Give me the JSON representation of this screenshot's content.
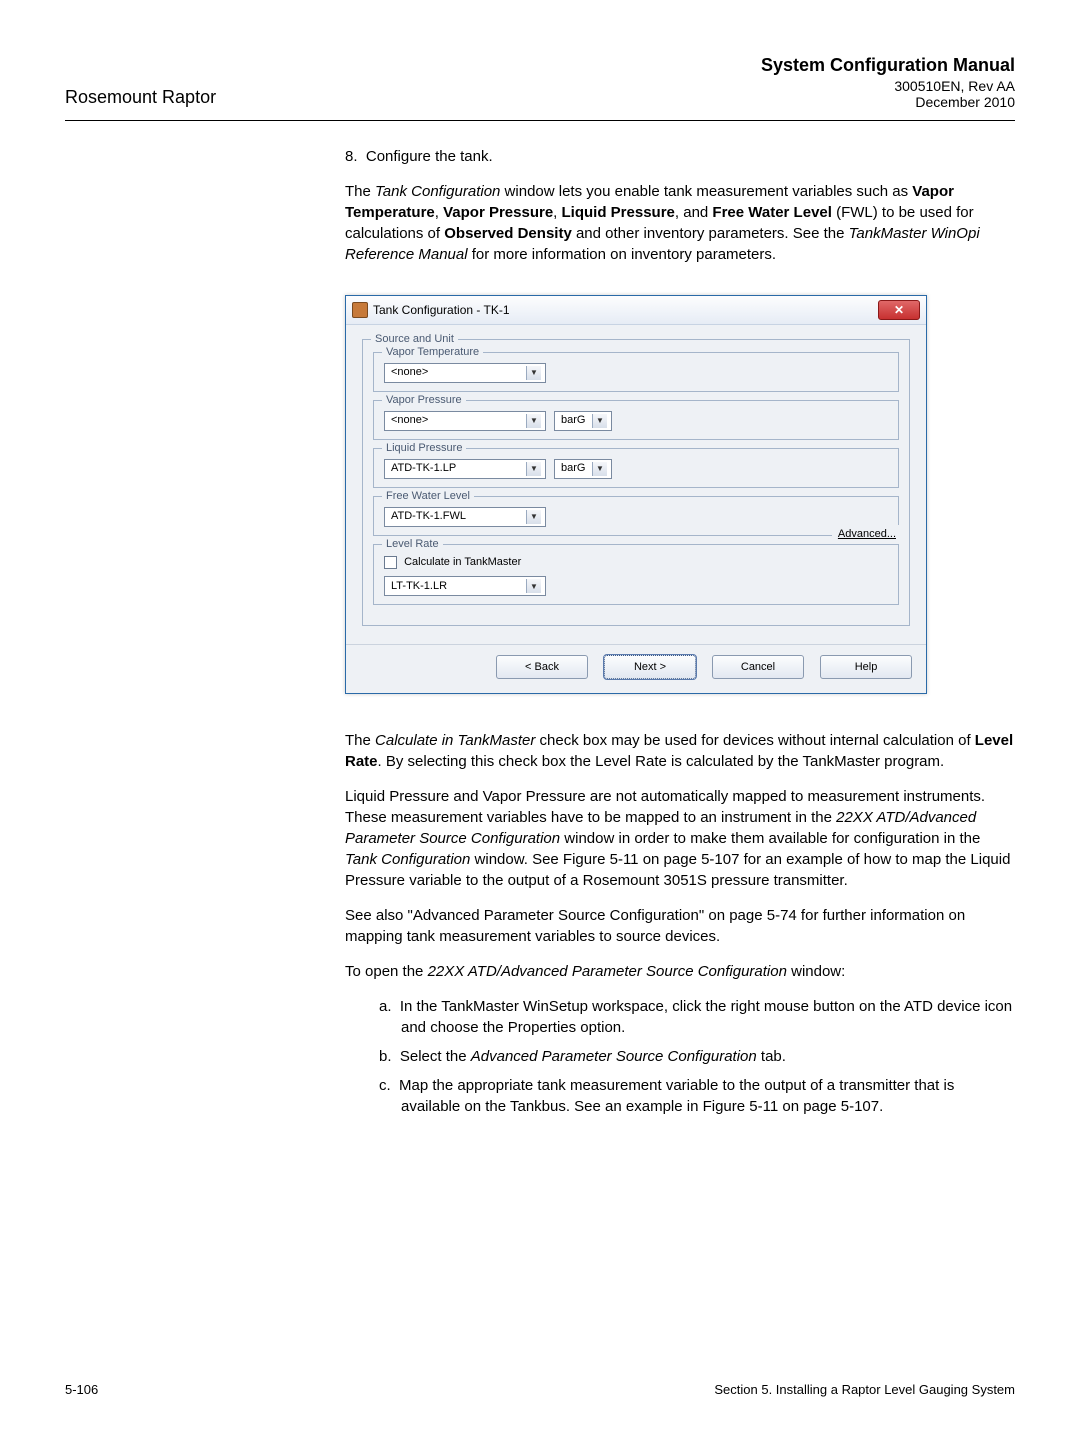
{
  "header": {
    "product": "Rosemount Raptor",
    "manual_title": "System Configuration Manual",
    "doc_no": "300510EN, Rev AA",
    "date": "December 2010"
  },
  "step8": {
    "num": "8.",
    "text": "Configure the tank."
  },
  "para1": {
    "l1": "The ",
    "i1": "Tank Configuration",
    "l2": " window lets you enable tank measurement variables such as ",
    "b1": "Vapor Temperature",
    "l3": ", ",
    "b2": "Vapor Pressure",
    "l4": ", ",
    "b3": "Liquid Pressure",
    "l5": ", and ",
    "b4": "Free Water Level",
    "l6": " (FWL) to be used for calculations of ",
    "b5": "Observed Density",
    "l7": " and other inventory parameters. See the ",
    "i2": "TankMaster WinOpi Reference Manual",
    "l8": " for more information on inventory parameters."
  },
  "dialog": {
    "title": "Tank Configuration - TK-1",
    "close": "✕",
    "group_source": "Source and Unit",
    "group_vt": "Vapor Temperature",
    "vt_val": "<none>",
    "group_vp": "Vapor Pressure",
    "vp_val": "<none>",
    "vp_unit": "barG",
    "group_lp": "Liquid Pressure",
    "lp_val": "ATD-TK-1.LP",
    "lp_unit": "barG",
    "group_fwl": "Free Water Level",
    "fwl_val": "ATD-TK-1.FWL",
    "group_lr": "Level Rate",
    "lr_chk": "Calculate in TankMaster",
    "lr_val": "LT-TK-1.LR",
    "advanced": "Advanced...",
    "btn_back": "< Back",
    "btn_next": "Next >",
    "btn_cancel": "Cancel",
    "btn_help": "Help"
  },
  "para2": {
    "l1": "The ",
    "i1": "Calculate in TankMaster",
    "l2": " check box may be used for devices without internal calculation of ",
    "b1": "Level Rate",
    "l3": ". By selecting this check box the Level Rate is calculated by the TankMaster program."
  },
  "para3": {
    "l1": "Liquid Pressure and Vapor Pressure are not automatically mapped to measurement instruments. These measurement variables have to be mapped to an instrument in the ",
    "i1": "22XX ATD/Advanced Parameter Source Configuration",
    "l2": " window in order to make them available for configuration in the ",
    "i2": "Tank Configuration",
    "l3": " window. See Figure 5-11 on page 5-107 for an example of how to map the Liquid Pressure variable to the output of a Rosemount 3051S pressure transmitter."
  },
  "para4": "See also \"Advanced Parameter Source Configuration\" on page 5-74 for further information on mapping tank measurement variables to source devices.",
  "para5": {
    "l1": "To open the ",
    "i1": "22XX ATD/Advanced Parameter Source Configuration",
    "l2": " window:"
  },
  "sub": {
    "a_num": "a.",
    "a_text": "In the TankMaster WinSetup workspace, click the right mouse button on the ATD device icon and choose the Properties option.",
    "b_num": "b.",
    "b_l1": "Select the ",
    "b_i1": "Advanced Parameter Source Configuration",
    "b_l2": " tab.",
    "c_num": "c.",
    "c_text": "Map the appropriate tank measurement variable to the output of a transmitter that is available on the Tankbus. See an example in Figure 5-11 on page 5-107."
  },
  "footer": {
    "page": "5-106",
    "section": "Section 5. Installing a Raptor Level Gauging System"
  }
}
